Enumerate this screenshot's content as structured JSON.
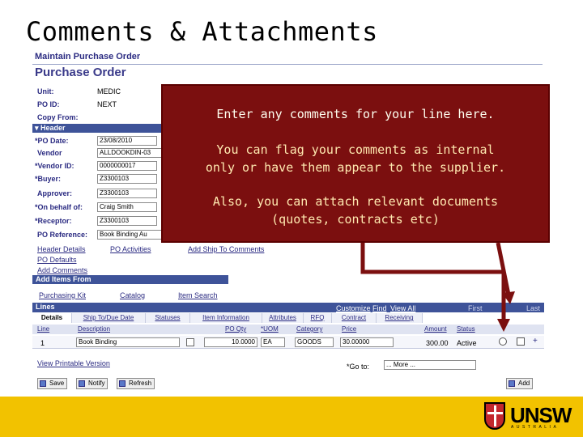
{
  "slide": {
    "title": "Comments & Attachments"
  },
  "page": {
    "breadcrumb": "Maintain Purchase Order",
    "title": "Purchase Order",
    "unit_label": "Unit:",
    "unit_value": "MEDIC",
    "poid_label": "PO ID:",
    "poid_value": "NEXT",
    "copy_from_label": "Copy From:",
    "header_section": "Header",
    "po_date_label": "*PO Date:",
    "po_date_value": "23/08/2010",
    "vendor_label": "Vendor",
    "vendor_value": "ALLDOOKDIN-03",
    "vendor_id_label": "*Vendor ID:",
    "vendor_id_value": "0000000017",
    "buyer_label": "*Buyer:",
    "buyer_value": "Z3300103",
    "approver_label": "Approver:",
    "approver_value": "Z3300103",
    "on_behalf_label": "*On behalf of:",
    "on_behalf_value": "Craig Smith",
    "receptor_label": "*Receptor:",
    "receptor_value": "Z3300103",
    "po_ref_label": "PO Reference:",
    "po_ref_value": "Book Binding Au",
    "links_row1": [
      "Header Details",
      "PO Activities",
      "Add Ship To Comments"
    ],
    "links_row2": [
      "PO Defaults",
      "Add Comments"
    ],
    "add_items_bar": "Add Items From",
    "add_items_links": [
      "Purchasing Kit",
      "Catalog",
      "Item Search"
    ],
    "lines_bar": "Lines",
    "lines_nav": {
      "customize": "Customize",
      "find": "Find",
      "view_all": "View All",
      "first": "First",
      "last": "Last"
    },
    "tabs": [
      "Details",
      "Ship To/Due Date",
      "Statuses",
      "Item Information",
      "Attributes",
      "RFQ",
      "Contract",
      "Receiving"
    ],
    "columns": [
      "Line",
      "Description",
      "PO Qty",
      "*UOM",
      "Category",
      "Price",
      "Amount",
      "Status"
    ],
    "row": {
      "line": "1",
      "description": "Book Binding",
      "qty": "10.0000",
      "uom": "EA",
      "category": "GOODS",
      "price": "30.00000",
      "amount": "300.00",
      "status": "Active"
    },
    "view_printable": "View Printable Version",
    "goto_label": "*Go to:",
    "goto_value": "... More ...",
    "buttons": {
      "save": "Save",
      "notify": "Notify",
      "refresh": "Refresh",
      "add": "Add"
    }
  },
  "callout": {
    "line1": "Enter any comments for your line here.",
    "line2a": "You can flag your comments as internal",
    "line2b": "only or have them appear to the supplier.",
    "line3a": "Also, you can attach relevant documents",
    "line3b": "(quotes, contracts etc)"
  },
  "logo": {
    "name": "UNSW",
    "subtitle": "AUSTRALIA"
  },
  "colors": {
    "callout_bg": "#7b0f0f",
    "footer": "#f2c200",
    "ps_blue": "#3e5399"
  }
}
